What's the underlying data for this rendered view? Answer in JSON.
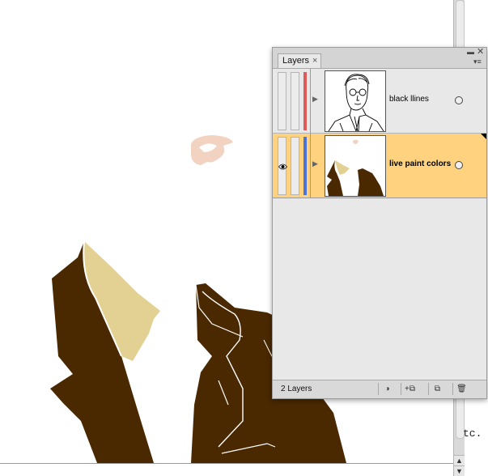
{
  "app": {
    "document_partial_text": "tc."
  },
  "layers_panel": {
    "tab_label": "Layers",
    "tab_close_glyph": "×",
    "collapse_glyph": "▬",
    "close_glyph": "✕",
    "menu_glyph": "▾≡",
    "layers": [
      {
        "name": "black llines",
        "visible": false,
        "color": "#e05a5a",
        "selected": false,
        "thumbnail": "portrait-line-art"
      },
      {
        "name": "live paint colors",
        "visible": true,
        "color": "#4a74d8",
        "selected": true,
        "thumbnail": "jacket-colors"
      }
    ],
    "footer": {
      "layer_count": "2 Layers",
      "buttons": [
        {
          "name": "make-clipping-mask-icon",
          "glyph": "◑"
        },
        {
          "name": "create-sublayer-icon",
          "glyph": "+⧉"
        },
        {
          "name": "create-new-layer-icon",
          "glyph": "⧉"
        },
        {
          "name": "delete-layer-icon",
          "glyph": "🗑"
        }
      ]
    }
  },
  "colors": {
    "jacket": "#4a2800",
    "collar": "#e3d193",
    "skin": "#f2d2c0",
    "selected_layer": "#ffd27f"
  },
  "scrollbar": {
    "up_arrow": "▲",
    "down_arrow": "▼"
  }
}
